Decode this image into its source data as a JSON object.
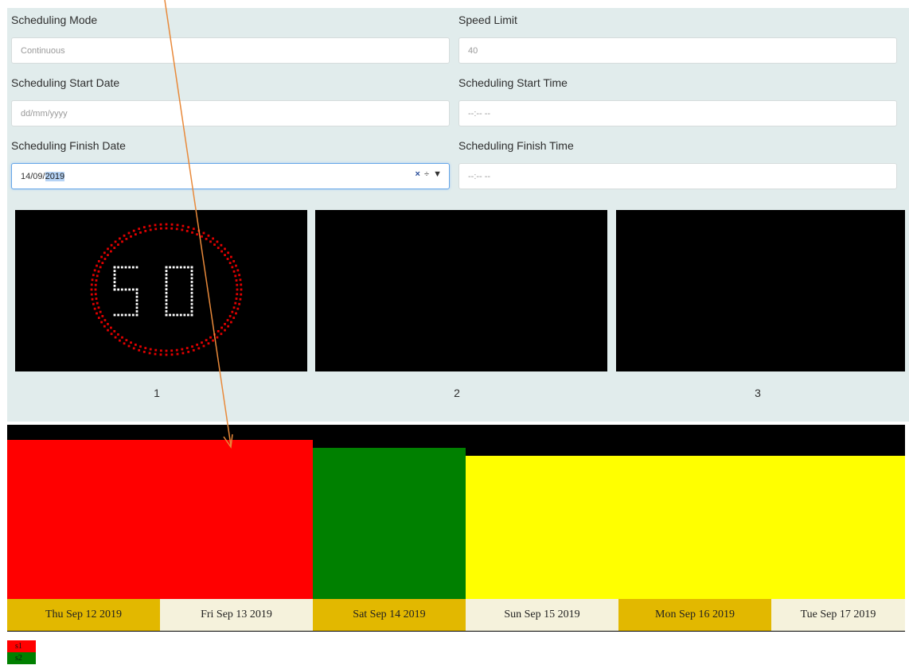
{
  "form": {
    "scheduling_mode": {
      "label": "Scheduling Mode",
      "value": "Continuous"
    },
    "speed_limit": {
      "label": "Speed Limit",
      "value": "40"
    },
    "start_date": {
      "label": "Scheduling Start Date",
      "placeholder": "dd/mm/yyyy"
    },
    "start_time": {
      "label": "Scheduling Start Time",
      "placeholder": "--:-- --"
    },
    "finish_date": {
      "label": "Scheduling Finish Date",
      "value_prefix": "14/09/",
      "value_selected": "2019",
      "clear_icon": "×",
      "spin_icon": "÷",
      "dropdown_icon": "▼"
    },
    "finish_time": {
      "label": "Scheduling Finish Time",
      "placeholder": "--:-- --"
    }
  },
  "signs": {
    "items": [
      {
        "number": "1",
        "display": "50",
        "ring_color": "#e00000",
        "digit_color": "#ffffff"
      },
      {
        "number": "2"
      },
      {
        "number": "3"
      }
    ]
  },
  "timeline": {
    "bars": [
      {
        "color": "#ff0000",
        "from": "Thu Sep 12 2019",
        "to": "Fri Sep 13 2019"
      },
      {
        "color": "#008000",
        "from": "Sat Sep 14 2019",
        "to": "Sat Sep 14 2019"
      },
      {
        "color": "#ffff00",
        "from": "Sun Sep 15 2019",
        "to": "Tue Sep 17 2019"
      }
    ],
    "dates": [
      "Thu Sep 12 2019",
      "Fri Sep 13 2019",
      "Sat Sep 14 2019",
      "Sun Sep 15 2019",
      "Mon Sep 16 2019",
      "Tue Sep 17 2019"
    ],
    "date_colors": [
      "#e2b800",
      "#f5f2dc"
    ]
  },
  "legend": [
    {
      "label": "s1",
      "color": "#ff0000"
    },
    {
      "label": "s2",
      "color": "#008000"
    }
  ],
  "annotation": {
    "arrow_color": "#e8893a"
  }
}
